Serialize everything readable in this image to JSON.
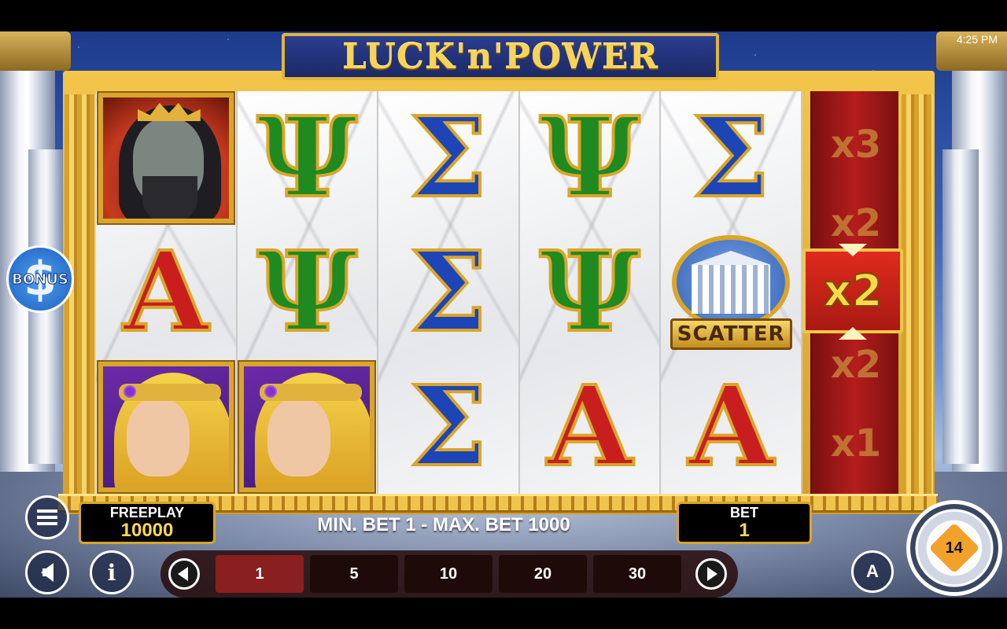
{
  "status_bar": {
    "time": "4:25 PM"
  },
  "game": {
    "title": "LUCK'n'POWER"
  },
  "reels": [
    [
      {
        "type": "portrait",
        "symbol": "zeus"
      },
      {
        "type": "letter",
        "symbol": "A"
      },
      {
        "type": "portrait",
        "symbol": "athena"
      }
    ],
    [
      {
        "type": "letter",
        "symbol": "Ψ"
      },
      {
        "type": "letter",
        "symbol": "Ψ"
      },
      {
        "type": "portrait",
        "symbol": "athena"
      }
    ],
    [
      {
        "type": "letter",
        "symbol": "Σ"
      },
      {
        "type": "letter",
        "symbol": "Σ"
      },
      {
        "type": "letter",
        "symbol": "Σ"
      }
    ],
    [
      {
        "type": "letter",
        "symbol": "Ψ"
      },
      {
        "type": "letter",
        "symbol": "Ψ"
      },
      {
        "type": "letter",
        "symbol": "A"
      }
    ],
    [
      {
        "type": "letter",
        "symbol": "Σ"
      },
      {
        "type": "scatter",
        "symbol": "temple"
      },
      {
        "type": "letter",
        "symbol": "A"
      }
    ]
  ],
  "scatter_label": "SCATTER",
  "multiplier_reel": {
    "values": [
      "x3",
      "x2",
      "x2",
      "x1"
    ],
    "active": "x2"
  },
  "bonus": {
    "label": "BONUS",
    "glyph": "$"
  },
  "freeplay": {
    "label": "FREEPLAY",
    "value": "10000"
  },
  "bet_range": "MIN. BET 1 - MAX. BET 1000",
  "bet": {
    "label": "BET",
    "value": "1"
  },
  "bet_options": [
    "1",
    "5",
    "10",
    "20",
    "30"
  ],
  "selected_bet": "1",
  "info_glyph": "i",
  "auto_glyph": "A",
  "spin_logo": "14",
  "colors": {
    "gold": "#d9a62b",
    "psi_green": "#1f8a1f",
    "sigma_blue": "#1e45b5",
    "alpha_red": "#c91e1e",
    "multi_red": "#b51d1d"
  }
}
